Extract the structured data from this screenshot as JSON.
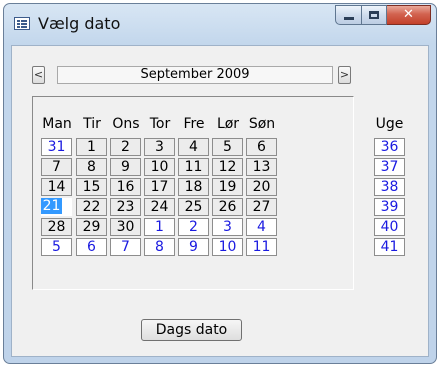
{
  "window": {
    "title": "Vælg dato"
  },
  "caption": {
    "close_glyph": "✕"
  },
  "nav": {
    "prev": "<",
    "next": ">",
    "month_label": "September 2009"
  },
  "weekday_headers": [
    "Man",
    "Tir",
    "Ons",
    "Tor",
    "Fre",
    "Lør",
    "Søn"
  ],
  "week_header": "Uge",
  "weeks": [
    {
      "number": "36",
      "days": [
        {
          "d": "31",
          "m": "other"
        },
        {
          "d": "1",
          "m": "cur"
        },
        {
          "d": "2",
          "m": "cur"
        },
        {
          "d": "3",
          "m": "cur"
        },
        {
          "d": "4",
          "m": "cur"
        },
        {
          "d": "5",
          "m": "cur"
        },
        {
          "d": "6",
          "m": "cur"
        }
      ]
    },
    {
      "number": "37",
      "days": [
        {
          "d": "7",
          "m": "cur"
        },
        {
          "d": "8",
          "m": "cur"
        },
        {
          "d": "9",
          "m": "cur"
        },
        {
          "d": "10",
          "m": "cur"
        },
        {
          "d": "11",
          "m": "cur"
        },
        {
          "d": "12",
          "m": "cur"
        },
        {
          "d": "13",
          "m": "cur"
        }
      ]
    },
    {
      "number": "38",
      "days": [
        {
          "d": "14",
          "m": "cur"
        },
        {
          "d": "15",
          "m": "cur"
        },
        {
          "d": "16",
          "m": "cur"
        },
        {
          "d": "17",
          "m": "cur"
        },
        {
          "d": "18",
          "m": "cur"
        },
        {
          "d": "19",
          "m": "cur"
        },
        {
          "d": "20",
          "m": "cur"
        }
      ]
    },
    {
      "number": "39",
      "days": [
        {
          "d": "21",
          "m": "sel"
        },
        {
          "d": "22",
          "m": "cur"
        },
        {
          "d": "23",
          "m": "cur"
        },
        {
          "d": "24",
          "m": "cur"
        },
        {
          "d": "25",
          "m": "cur"
        },
        {
          "d": "26",
          "m": "cur"
        },
        {
          "d": "27",
          "m": "cur"
        }
      ]
    },
    {
      "number": "40",
      "days": [
        {
          "d": "28",
          "m": "cur"
        },
        {
          "d": "29",
          "m": "cur"
        },
        {
          "d": "30",
          "m": "cur"
        },
        {
          "d": "1",
          "m": "other"
        },
        {
          "d": "2",
          "m": "other"
        },
        {
          "d": "3",
          "m": "other"
        },
        {
          "d": "4",
          "m": "other"
        }
      ]
    },
    {
      "number": "41",
      "days": [
        {
          "d": "5",
          "m": "other"
        },
        {
          "d": "6",
          "m": "other"
        },
        {
          "d": "7",
          "m": "other"
        },
        {
          "d": "8",
          "m": "other"
        },
        {
          "d": "9",
          "m": "other"
        },
        {
          "d": "10",
          "m": "other"
        },
        {
          "d": "11",
          "m": "other"
        }
      ]
    }
  ],
  "today_button": "Dags dato",
  "colors": {
    "selection": "#3399ff",
    "other_month_text": "#1a1ae0",
    "close_button": "#c3402a"
  }
}
